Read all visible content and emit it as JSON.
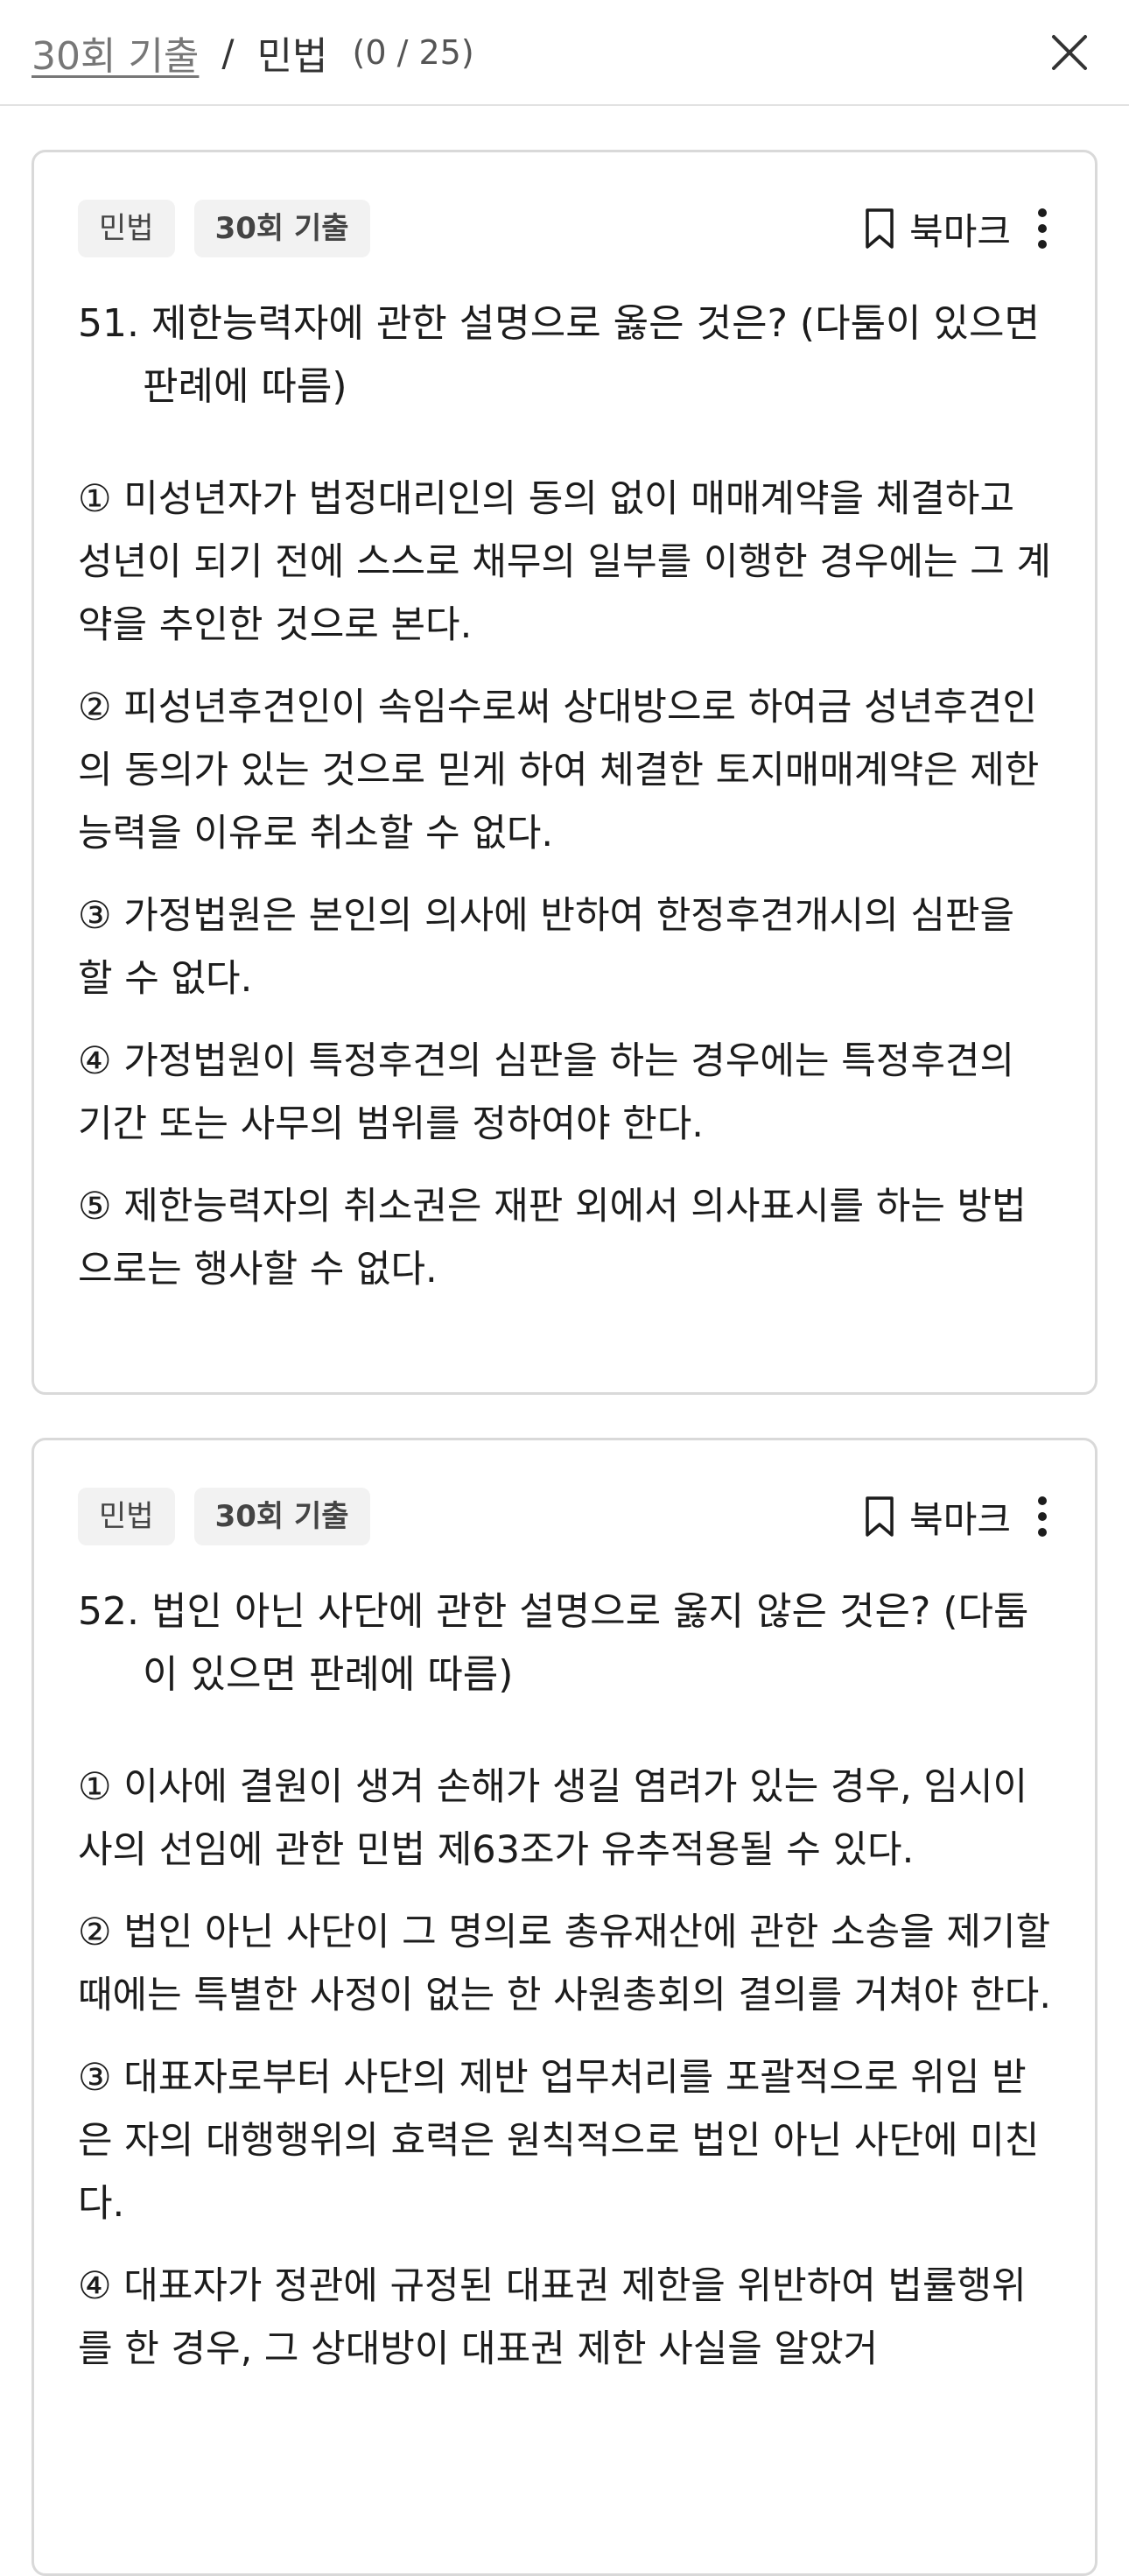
{
  "header": {
    "exam_link": "30회 기출",
    "separator": "/",
    "subject": "민법",
    "progress": "(0 / 25)"
  },
  "cards": [
    {
      "tags": [
        "민법",
        "30회 기출"
      ],
      "bookmark_label": "북마크",
      "question": "51. 제한능력자에 관한 설명으로 옳은 것은? (다툼이 있으면 판례에 따름)",
      "options": [
        "① 미성년자가 법정대리인의 동의 없이 매매계약을 체결하고 성년이 되기 전에 스스로 채무의 일부를 이행한 경우에는 그 계약을 추인한 것으로 본다.",
        "② 피성년후견인이 속임수로써 상대방으로 하여금 성년후견인의 동의가 있는 것으로 믿게 하여 체결한 토지매매계약은 제한능력을 이유로 취소할 수 없다.",
        "③ 가정법원은 본인의 의사에 반하여 한정후견개시의 심판을 할 수 없다.",
        "④ 가정법원이 특정후견의 심판을 하는 경우에는 특정후견의 기간 또는 사무의 범위를 정하여야 한다.",
        "⑤ 제한능력자의 취소권은 재판 외에서 의사표시를 하는 방법으로는 행사할 수 없다."
      ]
    },
    {
      "tags": [
        "민법",
        "30회 기출"
      ],
      "bookmark_label": "북마크",
      "question": "52. 법인 아닌 사단에 관한 설명으로 옳지 않은 것은? (다툼이 있으면 판례에 따름)",
      "options": [
        "① 이사에 결원이 생겨 손해가 생길 염려가 있는 경우, 임시이사의 선임에 관한 민법 제63조가 유추적용될 수 있다.",
        "② 법인 아닌 사단이 그 명의로 총유재산에 관한 소송을 제기할 때에는 특별한 사정이 없는 한 사원총회의 결의를 거쳐야 한다.",
        "③ 대표자로부터 사단의 제반 업무처리를 포괄적으로 위임 받은 자의 대행행위의 효력은 원칙적으로 법인 아닌 사단에 미친다.",
        "④ 대표자가 정관에 규정된 대표권 제한을 위반하여 법률행위를 한 경우, 그 상대방이 대표권 제한 사실을 알았거"
      ]
    }
  ]
}
